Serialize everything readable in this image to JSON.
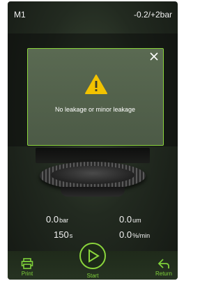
{
  "header": {
    "model": "M1",
    "range": "-0.2/+2bar"
  },
  "readings": [
    {
      "value": "0.0",
      "unit": "bar"
    },
    {
      "value": "0.0",
      "unit": "um"
    },
    {
      "value": "150",
      "unit": "s"
    },
    {
      "value": "0.0",
      "unit": "%/min"
    }
  ],
  "footer": {
    "print_label": "Print",
    "start_label": "Start",
    "return_label": "Return"
  },
  "dialog": {
    "message": "No leakage or minor leakage",
    "icon": "warning-icon"
  },
  "colors": {
    "accent": "#8ad53c",
    "warning": "#f2c200",
    "background": "#1c2219"
  }
}
